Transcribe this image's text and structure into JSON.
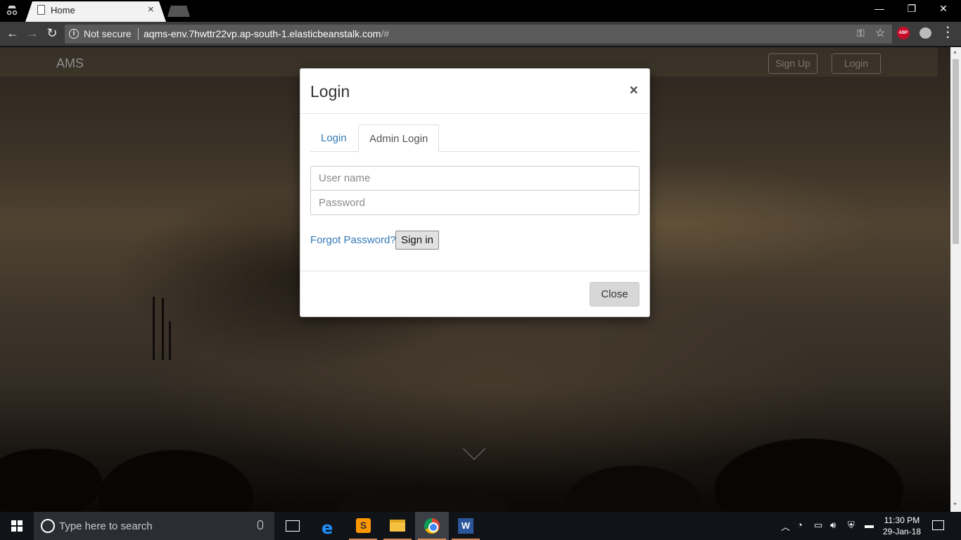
{
  "browser": {
    "tab_title": "Home",
    "security_label": "Not secure",
    "url_host": "aqms-env.7hwttr22vp.ap-south-1.elasticbeanstalk.com",
    "url_path": "/#",
    "extension_abp": "ABP"
  },
  "site": {
    "brand": "AMS",
    "nav": {
      "signup": "Sign Up",
      "login": "Login"
    }
  },
  "modal": {
    "title": "Login",
    "close_x": "×",
    "tabs": [
      {
        "label": "Login",
        "active": false
      },
      {
        "label": "Admin Login",
        "active": true
      }
    ],
    "username_placeholder": "User name",
    "password_placeholder": "Password",
    "forgot_link": "Forgot Password?",
    "signin_label": "Sign in",
    "close_label": "Close"
  },
  "taskbar": {
    "search_placeholder": "Type here to search",
    "apps": [
      "task-view",
      "edge",
      "sublime-text",
      "file-explorer",
      "chrome",
      "word"
    ],
    "time": "11:30 PM",
    "date": "29-Jan-18"
  }
}
